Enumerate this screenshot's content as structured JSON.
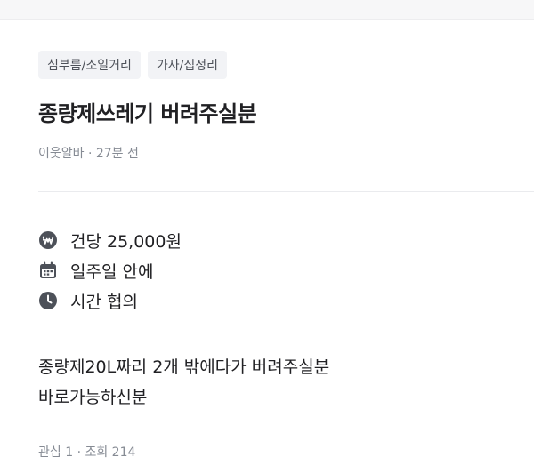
{
  "tags": [
    "심부름/소일거리",
    "가사/집정리"
  ],
  "post": {
    "title": "종량제쓰레기 버려주실분",
    "meta": "이웃알바 · 27분 전",
    "details": [
      {
        "icon": "won-icon",
        "text": "건당 25,000원"
      },
      {
        "icon": "calendar-icon",
        "text": "일주일 안에"
      },
      {
        "icon": "clock-icon",
        "text": "시간 협의"
      }
    ],
    "body_lines": [
      "종량제20L짜리 2개 밖에다가 버려주실분",
      "바로가능하신분"
    ],
    "stats": "관심 1 · 조회 214"
  },
  "colors": {
    "icon": "#4d5159",
    "muted": "#868b94",
    "tag_bg": "#f2f3f6"
  }
}
